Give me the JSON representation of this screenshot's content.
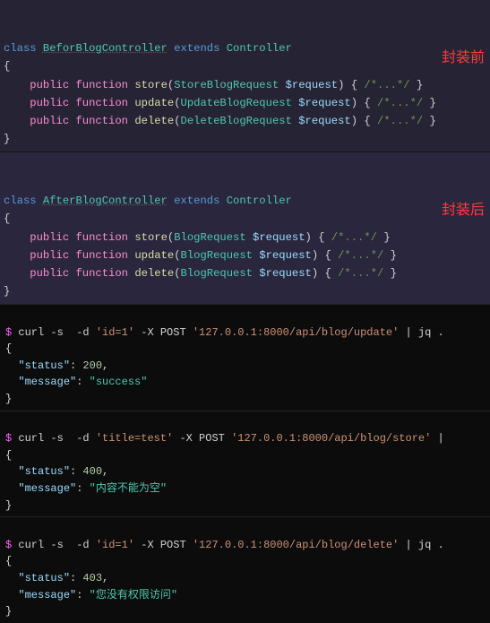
{
  "before": {
    "class_kw": "class",
    "class_name": "BeforBlogController",
    "extends_kw": "extends",
    "parent": "Controller",
    "public_kw": "public",
    "function_kw": "function",
    "methods": [
      {
        "name": "store",
        "param_type": "StoreBlogRequest",
        "param_var": "$request",
        "comment": "/*...*/"
      },
      {
        "name": "update",
        "param_type": "UpdateBlogRequest",
        "param_var": "$request",
        "comment": "/*...*/"
      },
      {
        "name": "delete",
        "param_type": "DeleteBlogRequest",
        "param_var": "$request",
        "comment": "/*...*/"
      }
    ],
    "annotation": "封装前"
  },
  "after": {
    "class_kw": "class",
    "class_name": "AfterBlogController",
    "extends_kw": "extends",
    "parent": "Controller",
    "public_kw": "public",
    "function_kw": "function",
    "methods": [
      {
        "name": "store",
        "param_type": "BlogRequest",
        "param_var": "$request",
        "comment": "/*...*/"
      },
      {
        "name": "update",
        "param_type": "BlogRequest",
        "param_var": "$request",
        "comment": "/*...*/"
      },
      {
        "name": "delete",
        "param_type": "BlogRequest",
        "param_var": "$request",
        "comment": "/*...*/"
      }
    ],
    "annotation": "封装后"
  },
  "terminal": [
    {
      "prompt": "$",
      "cmd_parts": [
        "curl",
        " -s  -d ",
        "'id=1'",
        " -X POST ",
        "'127.0.0.1:8000/api/blog/update'",
        " | ",
        "jq ."
      ],
      "response": {
        "status_key": "\"status\"",
        "status_val": "200",
        "message_key": "\"message\"",
        "message_val": "\"success\""
      }
    },
    {
      "prompt": "$",
      "cmd_parts": [
        "curl",
        " -s  -d ",
        "'title=test'",
        " -X POST ",
        "'127.0.0.1:8000/api/blog/store'",
        " | "
      ],
      "response": {
        "status_key": "\"status\"",
        "status_val": "400",
        "message_key": "\"message\"",
        "message_val": "\"内容不能为空\""
      }
    },
    {
      "prompt": "$",
      "cmd_parts": [
        "curl",
        " -s  -d ",
        "'id=1'",
        " -X POST ",
        "'127.0.0.1:8000/api/blog/delete'",
        " | ",
        "jq ."
      ],
      "response": {
        "status_key": "\"status\"",
        "status_val": "403",
        "message_key": "\"message\"",
        "message_val": "\"您没有权限访问\""
      }
    }
  ]
}
